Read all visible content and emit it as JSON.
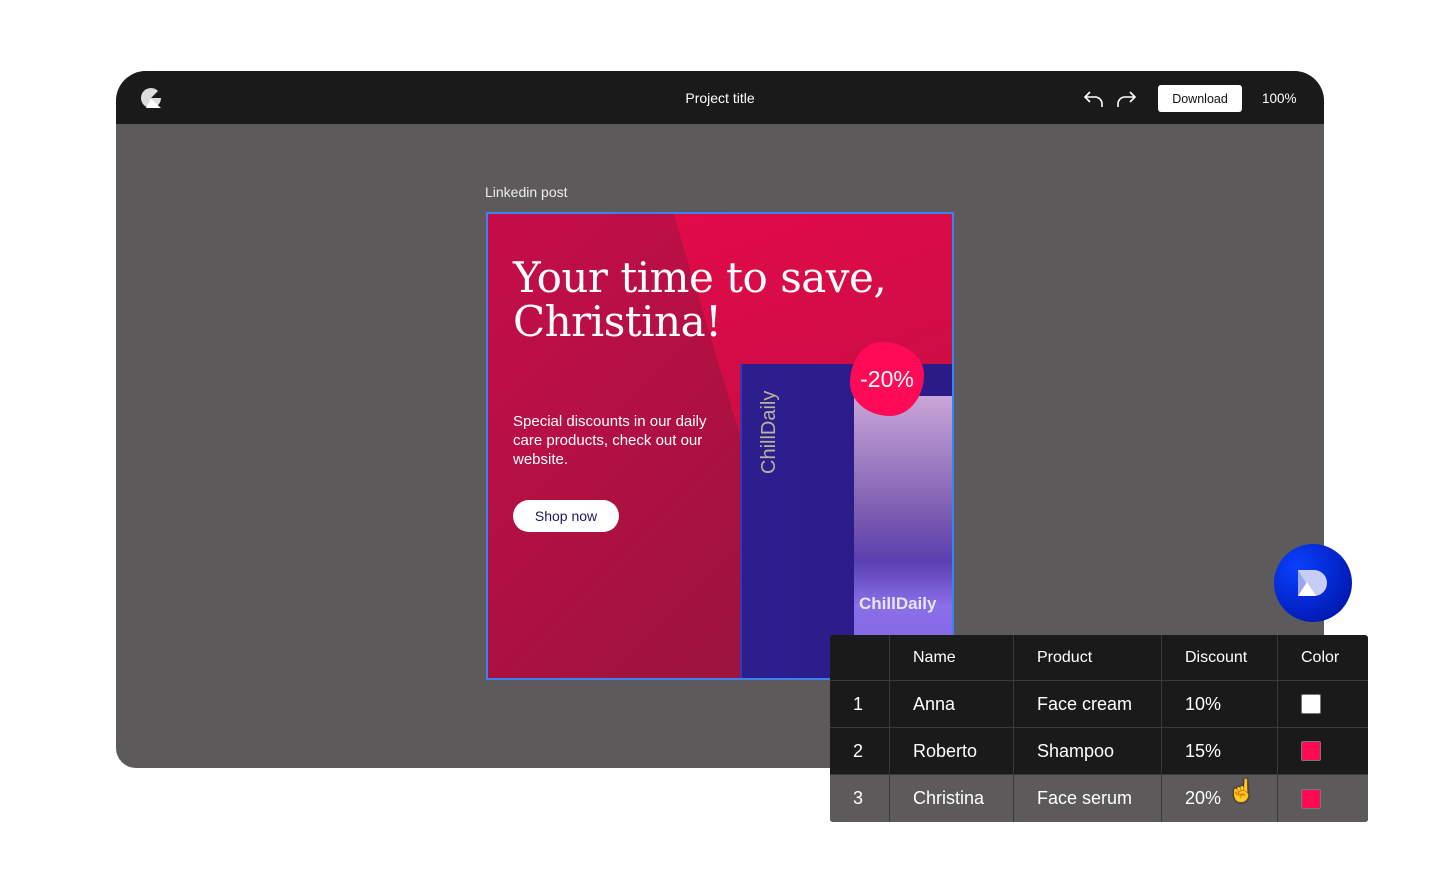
{
  "toolbar": {
    "title": "Project title",
    "download_label": "Download",
    "zoom": "100%"
  },
  "canvas": {
    "frame_label": "Linkedin post"
  },
  "post": {
    "headline_line1": "Your time to save,",
    "headline_line2": "Christina!",
    "body": "Special discounts in our daily care products, check out our website.",
    "cta": "Shop now",
    "badge": "-20%",
    "brand_box": "ChillDaily",
    "brand_bottle": "ChillDaily"
  },
  "table": {
    "headers": [
      "",
      "Name",
      "Product",
      "Discount",
      "Color"
    ],
    "rows": [
      {
        "n": "1",
        "name": "Anna",
        "product": "Face cream",
        "discount": "10%",
        "color": "#ffffff"
      },
      {
        "n": "2",
        "name": "Roberto",
        "product": "Shampoo",
        "discount": "15%",
        "color": "#ff0a56"
      },
      {
        "n": "3",
        "name": "Christina",
        "product": "Face serum",
        "discount": "20%",
        "color": "#ff0a56"
      }
    ]
  }
}
